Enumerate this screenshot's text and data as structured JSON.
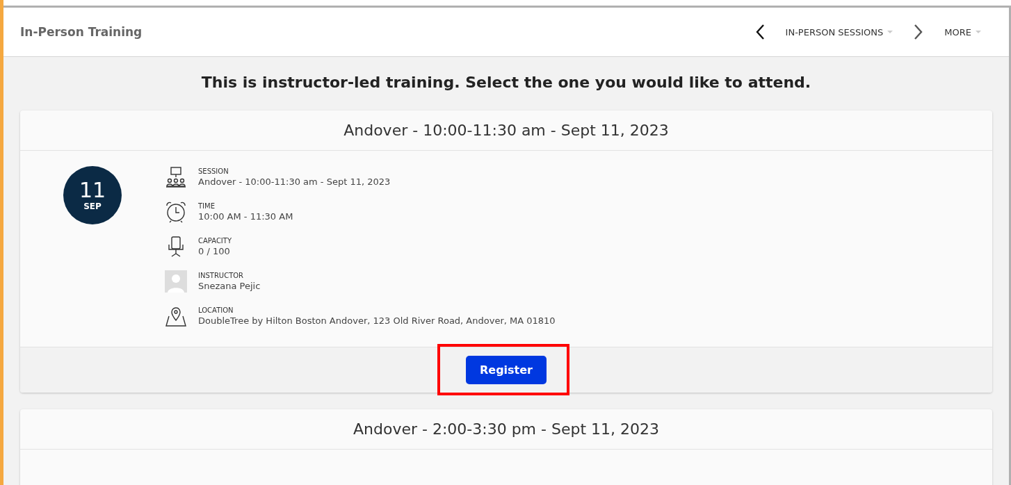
{
  "header": {
    "title": "In-Person Training",
    "nav": [
      {
        "kind": "prev"
      },
      {
        "kind": "menu",
        "label": "IN-PERSON SESSIONS"
      },
      {
        "kind": "next"
      },
      {
        "kind": "menu",
        "label": "MORE"
      }
    ]
  },
  "heading": "This is instructor-led training. Select the one you would like to attend.",
  "sessions": [
    {
      "title": "Andover - 10:00-11:30 am - Sept 11, 2023",
      "day": "11",
      "month": "SEP",
      "details": [
        {
          "kind": "session",
          "label": "SESSION",
          "value": "Andover - 10:00-11:30 am - Sept 11, 2023"
        },
        {
          "kind": "time",
          "label": "TIME",
          "value": "10:00 AM - 11:30 AM"
        },
        {
          "kind": "capacity",
          "label": "CAPACITY",
          "value": "0 / 100"
        },
        {
          "kind": "instructor",
          "label": "INSTRUCTOR",
          "value": "Snezana Pejic"
        },
        {
          "kind": "location",
          "label": "LOCATION",
          "value": "DoubleTree by Hilton Boston Andover, 123 Old River Road, Andover, MA 01810"
        }
      ],
      "button": {
        "label": "Register",
        "highlighted": true
      }
    },
    {
      "title": "Andover - 2:00-3:30 pm - Sept 11, 2023"
    }
  ]
}
